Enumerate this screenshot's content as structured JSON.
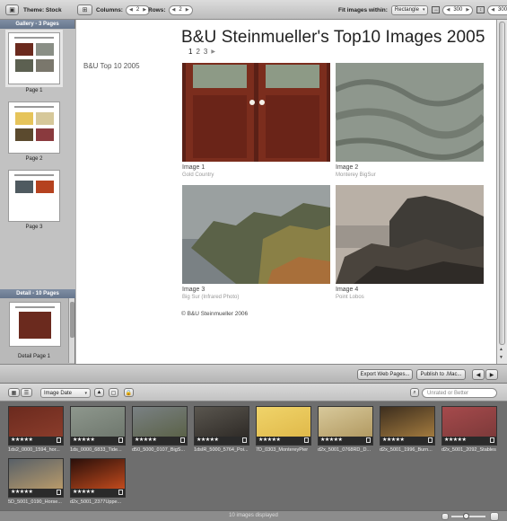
{
  "toolbar": {
    "theme_label": "Theme: Stock",
    "columns_label": "Columns:",
    "columns_value": "2",
    "rows_label": "Rows:",
    "rows_value": "2",
    "fit_label": "Fit images within:",
    "fit_value": "Rectangle",
    "width_value": "300",
    "height_value": "300"
  },
  "sidebar": {
    "gallery_header": "Gallery - 3 Pages",
    "pages": [
      {
        "label": "Page 1"
      },
      {
        "label": "Page 2"
      },
      {
        "label": "Page 3"
      }
    ],
    "detail_header": "Detail - 10 Pages",
    "detail_page_label": "Detail Page 1"
  },
  "canvas": {
    "site_title": "B&U Steinmueller's Top10 Images 2005",
    "site_nav": "B&U Top 10 2005",
    "pager": [
      "1",
      "2",
      "3"
    ],
    "images": [
      {
        "title": "Image 1",
        "subtitle": "Gold Country"
      },
      {
        "title": "Image 2",
        "subtitle": "Monterey BigSur"
      },
      {
        "title": "Image 3",
        "subtitle": "Big Sur (Infrared Photo)"
      },
      {
        "title": "Image 4",
        "subtitle": "Point Lobos"
      }
    ],
    "copyright": "© B&U Steinmueller 2006"
  },
  "actions": {
    "export_label": "Export Web Pages...",
    "publish_label": "Publish to .Mac..."
  },
  "browser": {
    "sort_value": "Image Date",
    "search_placeholder": "Unrated or Better",
    "status_text": "10 images displayed",
    "rating": "★★★★★",
    "photos": [
      {
        "name": "1ds2_0000_1594_hor..."
      },
      {
        "name": "1ds_0000_6833_Tide..."
      },
      {
        "name": "d50_5000_0107_BigS..."
      },
      {
        "name": "1dsIR_5000_5764_Poi..."
      },
      {
        "name": "7D_0303_MontereyPier"
      },
      {
        "name": "d2x_5001_0768RD_D..."
      },
      {
        "name": "d2x_5001_1996_Burn..."
      },
      {
        "name": "d2x_5001_2092_Stables"
      },
      {
        "name": "5D_5001_0190_Horse..."
      },
      {
        "name": "d2x_5001_2377Uppe..."
      }
    ]
  },
  "colors": {
    "header_blue": "#6f7f96",
    "door_red": "#7a2a1c",
    "browser_bg": "#6e6e6e"
  }
}
